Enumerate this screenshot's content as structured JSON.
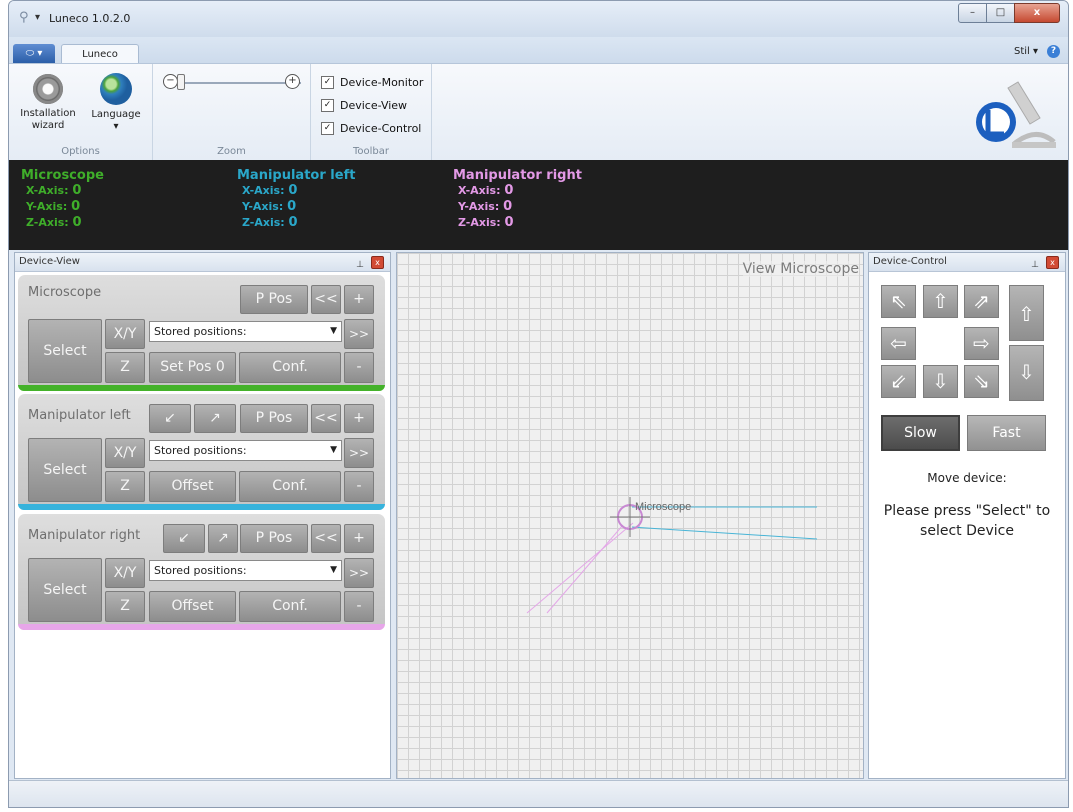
{
  "window": {
    "title": "Luneco 1.0.2.0",
    "quick_access": "▾",
    "controls": {
      "minimize": "–",
      "maximize": "□",
      "close": "x"
    }
  },
  "ribbon_tabs": {
    "app_menu": "⬭ ▾",
    "luneco": "Luneco",
    "style_menu": "Stil ▾",
    "help": "?"
  },
  "ribbon": {
    "options": {
      "installation_wizard": "Installation wizard",
      "language": "Language",
      "language_dropdown": "▾",
      "label": "Options"
    },
    "zoom": {
      "label": "Zoom",
      "minus": "−",
      "plus": "+",
      "level": 0.05
    },
    "toolbar": {
      "label": "Toolbar",
      "check_mark": "✓",
      "items": [
        {
          "label": "Device-Monitor",
          "checked": true
        },
        {
          "label": "Device-View",
          "checked": true
        },
        {
          "label": "Device-Control",
          "checked": true
        }
      ]
    }
  },
  "monitor": {
    "microscope": {
      "title": "Microscope",
      "x_label": "X-Axis:",
      "x": "0",
      "y_label": "Y-Axis:",
      "y": "0",
      "z_label": "Z-Axis:",
      "z": "0",
      "color": "#3fae2a"
    },
    "manip_left": {
      "title": "Manipulator left",
      "x_label": "X-Axis:",
      "x": "0",
      "y_label": "Y-Axis:",
      "y": "0",
      "z_label": "Z-Axis:",
      "z": "0",
      "color": "#2aa7c9"
    },
    "manip_right": {
      "title": "Manipulator right",
      "x_label": "X-Axis:",
      "x": "0",
      "y_label": "Y-Axis:",
      "y": "0",
      "z_label": "Z-Axis:",
      "z": "0",
      "color": "#e399e6"
    }
  },
  "device_view": {
    "header": "Device-View",
    "pin": "⊥",
    "close": "x",
    "microscope": {
      "name": "Microscope",
      "select": "Select",
      "xy": "X/Y",
      "z": "Z",
      "ppos": "P Pos",
      "prev": "<<",
      "next": ">>",
      "plus": "+",
      "minus": "-",
      "stored": "Stored positions:",
      "setpos": "Set Pos 0",
      "conf": "Conf.",
      "color": "#44b22a"
    },
    "manip_left": {
      "name": "Manipulator left",
      "select": "Select",
      "xy": "X/Y",
      "z": "Z",
      "arrow_in": "↙",
      "arrow_out": "↗",
      "ppos": "P Pos",
      "prev": "<<",
      "next": ">>",
      "plus": "+",
      "minus": "-",
      "stored": "Stored positions:",
      "offset": "Offset",
      "conf": "Conf.",
      "color": "#37b3dc"
    },
    "manip_right": {
      "name": "Manipulator right",
      "select": "Select",
      "xy": "X/Y",
      "z": "Z",
      "arrow_in": "↙",
      "arrow_out": "↗",
      "ppos": "P Pos",
      "prev": "<<",
      "next": ">>",
      "plus": "+",
      "minus": "-",
      "stored": "Stored positions:",
      "offset": "Offset",
      "conf": "Conf.",
      "color": "#e7a6e9"
    }
  },
  "view": {
    "title": "View Microscope",
    "marker_label": "Microscope"
  },
  "device_control": {
    "header": "Device-Control",
    "pin": "⊥",
    "close": "x",
    "arrows": {
      "up_left": "⇖",
      "up": "⇧",
      "up_right": "⇗",
      "left": "⇦",
      "right": "⇨",
      "down_left": "⇙",
      "down": "⇩",
      "down_right": "⇘",
      "z_up": "⇧",
      "z_down": "⇩"
    },
    "slow": "Slow",
    "fast": "Fast",
    "selected_speed": "Slow",
    "move_label": "Move device:",
    "message": "Please press \"Select\" to select Device"
  }
}
